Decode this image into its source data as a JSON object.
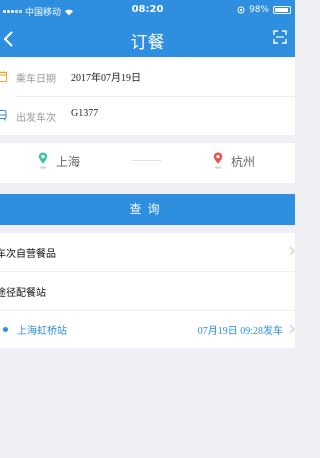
{
  "status_bar": {
    "carrier": "中国移动",
    "time": "08:20",
    "battery": "98%"
  },
  "nav": {
    "title": "订餐",
    "back_icon": "chevron-left-icon",
    "scan_icon": "scan-icon"
  },
  "form": {
    "date_label": "乘车日期",
    "date_value": "2017年07月19日",
    "train_label": "出发车次",
    "train_value": "G1377"
  },
  "route": {
    "from": "上海",
    "to": "杭州",
    "from_pin_color": "#3ec7a4",
    "to_pin_color": "#e8524a"
  },
  "query_button": "查询",
  "sections": {
    "onboard": "车次自营餐品",
    "stations": "途径配餐站"
  },
  "stops": [
    {
      "name": "上海虹桥站",
      "time": "07月19日 09:28发车"
    }
  ],
  "colors": {
    "primary": "#2e8ee0",
    "background": "#efeff4"
  }
}
